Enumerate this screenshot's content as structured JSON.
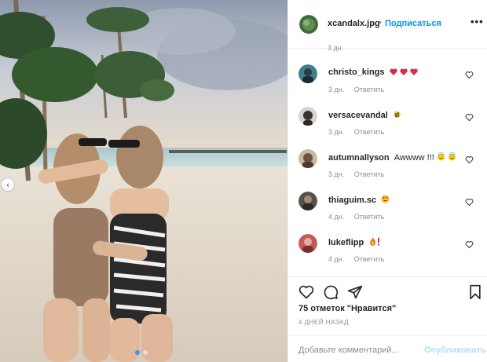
{
  "post": {
    "username": "xcandalx.jpg",
    "separator": "•",
    "follow_label": "Подписаться",
    "more_label": "•••"
  },
  "comments": {
    "partial_meta": "3 дн.",
    "items": [
      {
        "username": "christo_kings",
        "text": "",
        "emoji": [
          "heart-emoji",
          "heart-emoji",
          "heart-emoji"
        ],
        "time": "3 дн.",
        "reply": "Ответить"
      },
      {
        "username": "versacevandal",
        "text": "",
        "emoji": [
          "bee-emoji"
        ],
        "time": "3 дн.",
        "reply": "Ответить"
      },
      {
        "username": "autumnallyson",
        "text": "Awwww !!!",
        "emoji": [
          "smile-halo-emoji",
          "smile-halo-emoji"
        ],
        "time": "3 дн.",
        "reply": "Ответить"
      },
      {
        "username": "thiaguim.sc",
        "text": "",
        "emoji": [
          "heart-eyes-emoji"
        ],
        "time": "4 дн.",
        "reply": "Ответить"
      },
      {
        "username": "lukeflipp",
        "text": "",
        "emoji": [
          "fire-emoji",
          "exclamation-emoji"
        ],
        "time": "4 дн.",
        "reply": "Ответить"
      }
    ]
  },
  "actions": {
    "likes_label": "75 отметок \"Нравится\"",
    "date_label": "4 ДНЕЙ НАЗАД"
  },
  "add_comment": {
    "placeholder": "Добавьте комментарий...",
    "post_label": "Опубликовать"
  },
  "carousel": {
    "prev_icon": "chevron-left-icon",
    "prev_glyph": "‹",
    "slide_count": 2,
    "active_slide": 1
  },
  "colors": {
    "accent": "#0095f6",
    "post_disabled": "#b2dffc",
    "heart_emoji": "#d62d4b",
    "muted_text": "#8e8e8e"
  }
}
